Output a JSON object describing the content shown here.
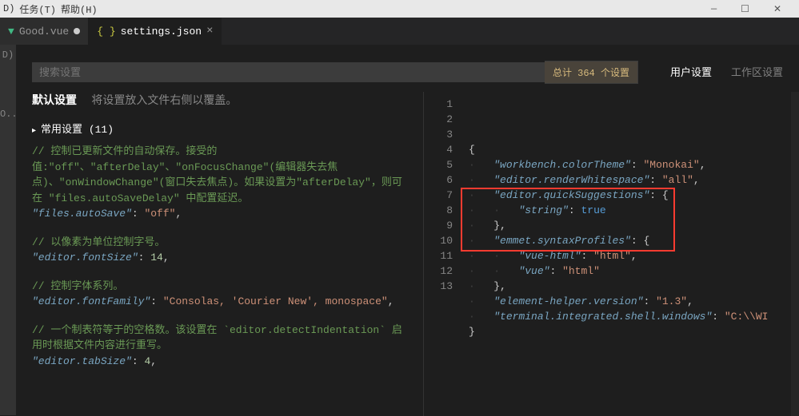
{
  "menu": {
    "tasks": "任务(T)",
    "help": "帮助(H)"
  },
  "window_controls": {
    "min": "—",
    "max": "☐",
    "close": "✕"
  },
  "tabs": [
    {
      "icon": "vue-icon",
      "label": "Good.vue",
      "dirty": true,
      "active": false
    },
    {
      "icon": "json-icon",
      "label": "settings.json",
      "dirty": false,
      "active": true
    }
  ],
  "activity_partial": "D)\nO...",
  "search": {
    "placeholder": "搜索设置",
    "badge": "总计 364 个设置"
  },
  "settings_scope": {
    "user": "用户设置",
    "workspace": "工作区设置"
  },
  "left": {
    "default_title": "默认设置",
    "default_hint": "将设置放入文件右侧以覆盖。",
    "section": "常用设置 (11)",
    "items": [
      {
        "comment": "// 控制已更新文件的自动保存。接受的值:\"off\"、\"afterDelay\"、\"onFocusChange\"(编辑器失去焦点)、\"onWindowChange\"(窗口失去焦点)。如果设置为\"afterDelay\"，则可在 \"files.autoSaveDelay\" 中配置延迟。",
        "key": "\"files.autoSave\"",
        "value": "\"off\"",
        "vtype": "string"
      },
      {
        "comment": "// 以像素为单位控制字号。",
        "key": "\"editor.fontSize\"",
        "value": "14",
        "vtype": "num"
      },
      {
        "comment": "// 控制字体系列。",
        "key": "\"editor.fontFamily\"",
        "value": "\"Consolas, 'Courier New', monospace\"",
        "vtype": "string"
      },
      {
        "comment": "// 一个制表符等于的空格数。该设置在 `editor.detectIndentation` 启用时根据文件内容进行重写。",
        "key": "\"editor.tabSize\"",
        "value": "4",
        "vtype": "num"
      }
    ]
  },
  "right": {
    "lines": [
      {
        "n": 1,
        "text": "{"
      },
      {
        "n": 2,
        "indent": 1,
        "key": "\"workbench.colorTheme\"",
        "sep": ": ",
        "val": "\"Monokai\"",
        "tail": ","
      },
      {
        "n": 3,
        "indent": 1,
        "key": "\"editor.renderWhitespace\"",
        "sep": ": ",
        "val": "\"all\"",
        "tail": ","
      },
      {
        "n": 4,
        "indent": 1,
        "key": "\"editor.quickSuggestions\"",
        "sep": ": ",
        "brace": "{"
      },
      {
        "n": 5,
        "indent": 2,
        "key": "\"string\"",
        "sep": ": ",
        "bool": "true"
      },
      {
        "n": 6,
        "indent": 1,
        "brace": "},"
      },
      {
        "n": 7,
        "indent": 1,
        "key": "\"emmet.syntaxProfiles\"",
        "sep": ": ",
        "brace": "{"
      },
      {
        "n": 8,
        "indent": 2,
        "key": "\"vue-html\"",
        "sep": ": ",
        "val": "\"html\"",
        "tail": ","
      },
      {
        "n": 9,
        "indent": 2,
        "key": "\"vue\"",
        "sep": ": ",
        "val": "\"html\""
      },
      {
        "n": 10,
        "indent": 1,
        "brace": "},"
      },
      {
        "n": 11,
        "indent": 1,
        "key": "\"element-helper.version\"",
        "sep": ": ",
        "val": "\"1.3\"",
        "tail": ","
      },
      {
        "n": 12,
        "indent": 1,
        "key": "\"terminal.integrated.shell.windows\"",
        "sep": ": ",
        "val": "\"C:\\\\WI"
      },
      {
        "n": 13,
        "text": "}"
      }
    ]
  }
}
